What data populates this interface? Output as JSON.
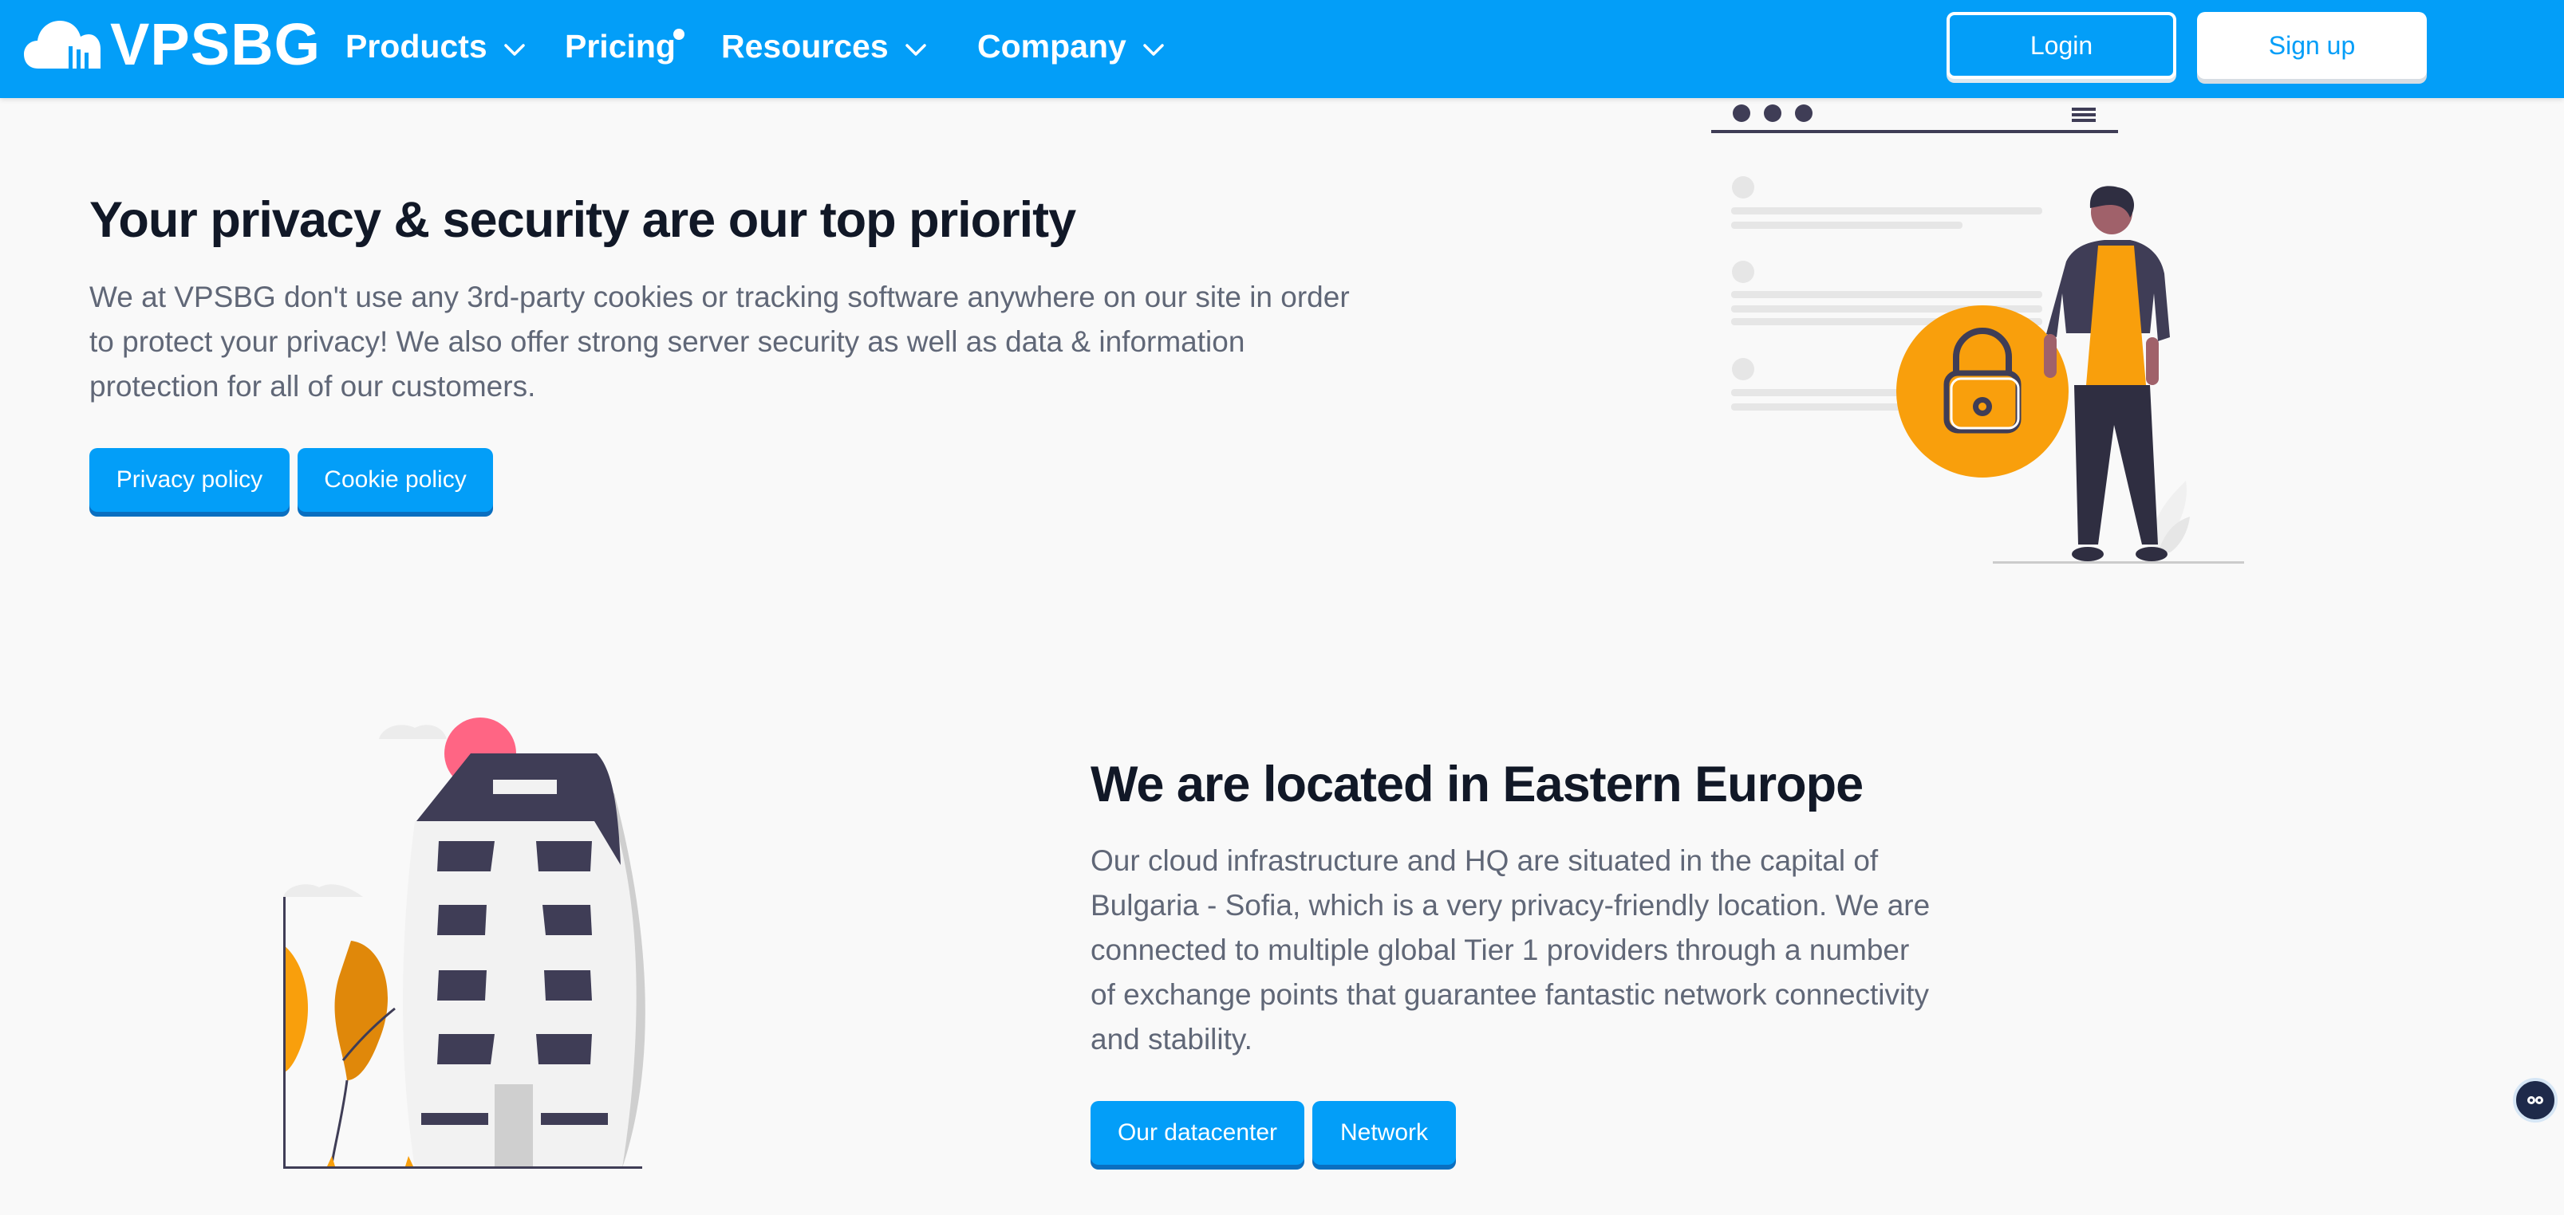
{
  "header": {
    "brand": "VPSBG",
    "nav": [
      {
        "label": "Products",
        "has_dropdown": true
      },
      {
        "label": "Pricing",
        "has_dropdown": false,
        "has_badge_dot": true
      },
      {
        "label": "Resources",
        "has_dropdown": true
      },
      {
        "label": "Company",
        "has_dropdown": true
      }
    ],
    "login_label": "Login",
    "signup_label": "Sign up"
  },
  "privacy": {
    "title": "Your privacy & security are our top priority",
    "body": "We at VPSBG don't use any 3rd-party cookies or tracking software anywhere on our site in order to protect your privacy! We also offer strong server security as well as data & information protection for all of our customers.",
    "buttons": [
      "Privacy policy",
      "Cookie policy"
    ]
  },
  "location": {
    "title": "We are located in Eastern Europe",
    "body": "Our cloud infrastructure and HQ are situated in the capital of Bulgaria - Sofia, which is a very privacy-friendly location. We are connected to multiple global Tier 1 providers through a number of exchange points that guarantee fantastic network connectivity and stability.",
    "buttons": [
      "Our datacenter",
      "Network"
    ]
  },
  "icons": {
    "logo": "cloud-logo-icon",
    "chevron": "chevron-down-icon",
    "chat": "chat-widget-icon",
    "illustration_privacy": "security-lock-illustration",
    "illustration_location": "building-illustration"
  },
  "colors": {
    "brand_blue": "#039ef8",
    "heading": "#111827",
    "text": "#606777",
    "accent_orange": "#f99f0c",
    "dark_navy": "#3f3d56",
    "background": "#f9f9f9"
  }
}
